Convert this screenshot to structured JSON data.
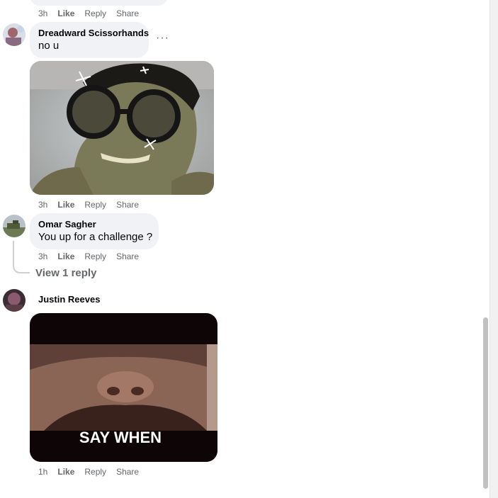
{
  "comments": [
    {
      "id": "top-partial",
      "actions": {
        "time": "3h",
        "like": "Like",
        "reply": "Reply",
        "share": "Share"
      }
    },
    {
      "id": "dreadward",
      "author": "Dreadward Scissorhands",
      "text": "no u",
      "more": "···",
      "actions": {
        "time": "3h",
        "like": "Like",
        "reply": "Reply",
        "share": "Share"
      }
    },
    {
      "id": "omar",
      "author": "Omar Sagher",
      "text": "You up for a challenge ?",
      "actions": {
        "time": "3h",
        "like": "Like",
        "reply": "Reply",
        "share": "Share"
      },
      "view_replies": "View 1 reply"
    },
    {
      "id": "justin",
      "author": "Justin Reeves",
      "gif_caption": "SAY WHEN",
      "actions": {
        "time": "1h",
        "like": "Like",
        "reply": "Reply",
        "share": "Share"
      }
    }
  ],
  "colors": {
    "bubble": "#f0f2f5",
    "meta_text": "#65676b",
    "text": "#050505"
  }
}
